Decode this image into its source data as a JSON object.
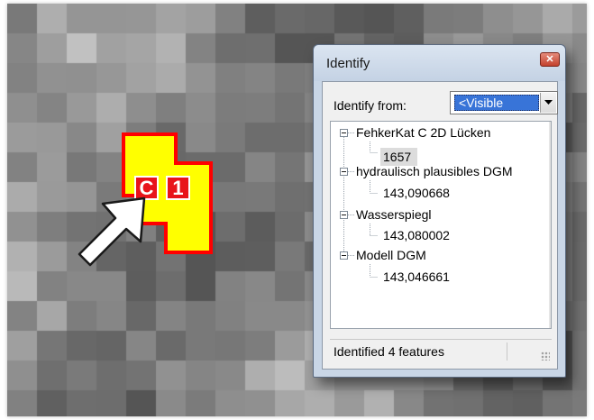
{
  "map": {
    "labels": [
      "C",
      "1"
    ],
    "colors": {
      "polygon_fill": "#ffff00",
      "polygon_outline": "#ff0000",
      "label_box": "#e8141b"
    }
  },
  "identify": {
    "title": "Identify",
    "close_icon": "close-x-icon",
    "from_label": "Identify from:",
    "from_value": "<Visible",
    "tree": [
      {
        "layer": "FehkerKat C 2D Lücken",
        "value": "1657"
      },
      {
        "layer": "hydraulisch plausibles DGM",
        "value": "143,090668"
      },
      {
        "layer": "Wasserspiegl",
        "value": "143,080002"
      },
      {
        "layer": "Modell DGM",
        "value": "143,046661"
      }
    ],
    "status": "Identified 4 features"
  }
}
